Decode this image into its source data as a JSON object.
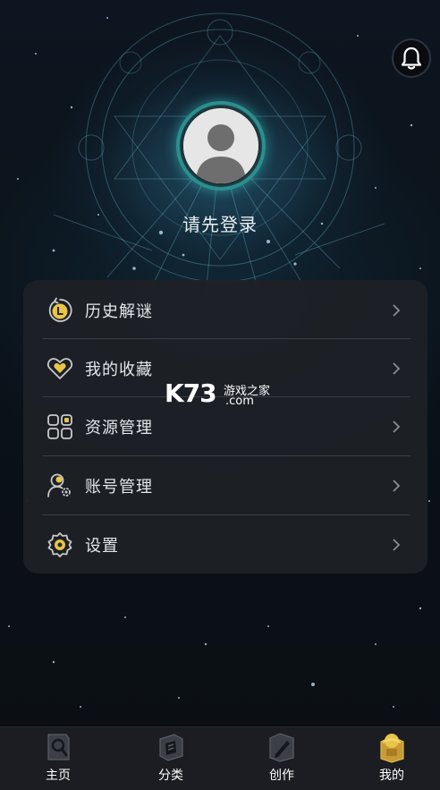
{
  "header": {
    "notification_icon": "bell-icon"
  },
  "profile": {
    "avatar_icon": "default-avatar-icon",
    "login_prompt": "请先登录",
    "accent_color": "#2b8f8f"
  },
  "menu": {
    "items": [
      {
        "icon": "clock-icon",
        "label": "历史解谜"
      },
      {
        "icon": "heart-icon",
        "label": "我的收藏"
      },
      {
        "icon": "grid-icon",
        "label": "资源管理"
      },
      {
        "icon": "user-gear-icon",
        "label": "账号管理"
      },
      {
        "icon": "settings-gear-icon",
        "label": "设置"
      }
    ],
    "icon_color": "#e8c547"
  },
  "watermark": {
    "brand": "K73",
    "site_name": "游戏之家",
    "domain": ".com"
  },
  "tabbar": {
    "tabs": [
      {
        "icon": "home-icon",
        "label": "主页",
        "active": false
      },
      {
        "icon": "category-icon",
        "label": "分类",
        "active": false
      },
      {
        "icon": "create-icon",
        "label": "创作",
        "active": false
      },
      {
        "icon": "mine-icon",
        "label": "我的",
        "active": true
      }
    ],
    "active_color": "#e0b84a"
  }
}
